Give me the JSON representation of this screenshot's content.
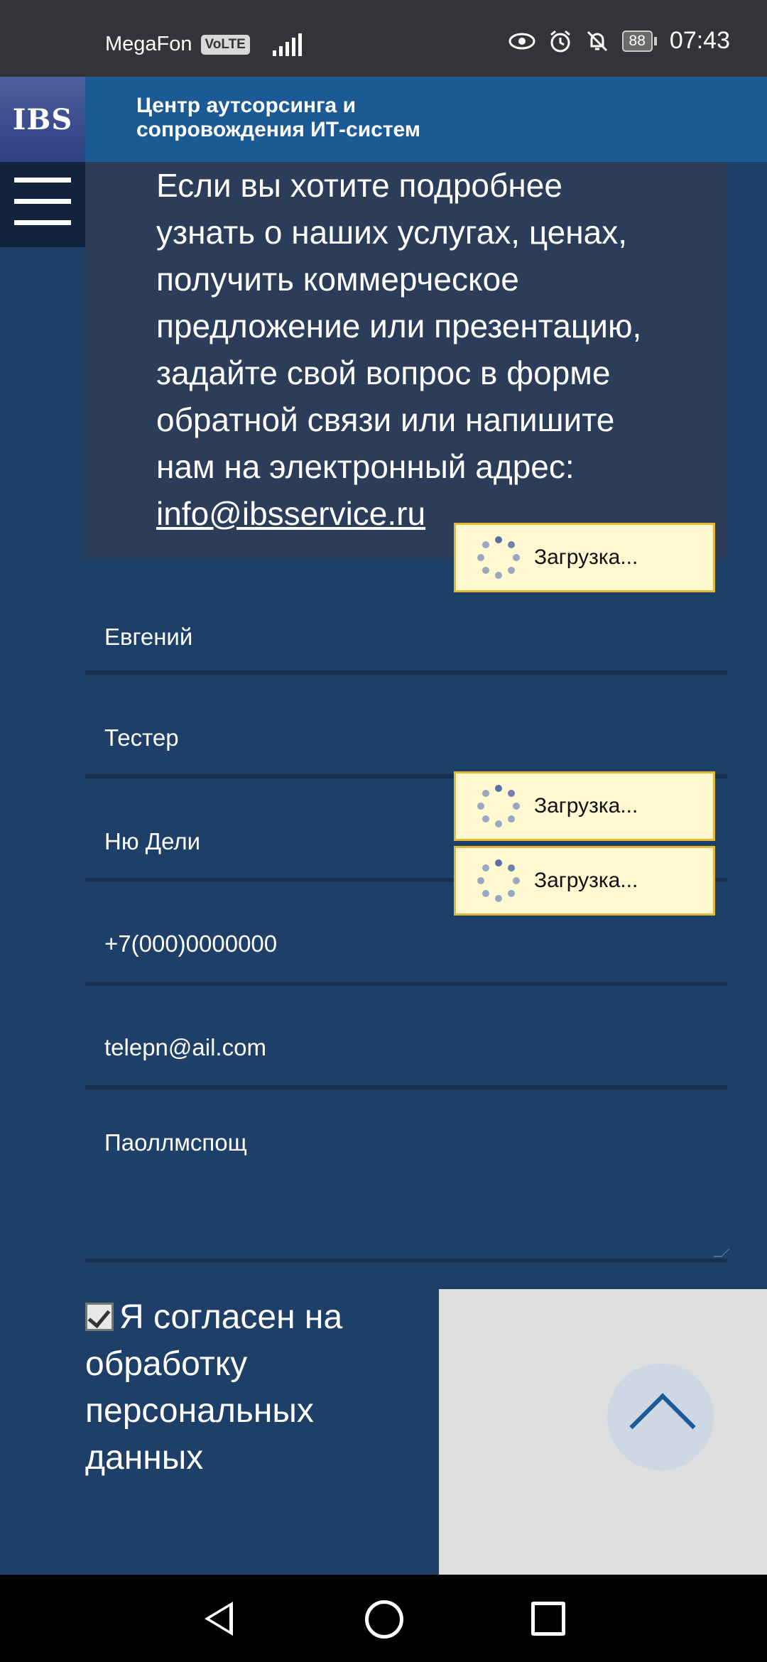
{
  "status_bar": {
    "carrier": "MegaFon",
    "volte": "VoLTE",
    "battery": "88",
    "time": "07:43"
  },
  "header": {
    "logo": "IBS",
    "title_line1": "Центр аутсорсинга и",
    "title_line2": "сопровождения ИТ-систем"
  },
  "info": {
    "line1": "Если вы хотите подробнее",
    "line2": "узнать о наших услугах, ценах,",
    "line3": "получить коммерческое",
    "line4": "предложение или презентацию,",
    "line5": "задайте свой вопрос в форме",
    "line6": "обратной связи или напишите",
    "line7": "нам на электронный адрес:",
    "email": "info@ibsservice.ru"
  },
  "form": {
    "first_name": "Евгений",
    "last_name": "Тестер",
    "city": "Ню Дели",
    "phone": "+7(000)0000000",
    "email": "telepn@ail.com",
    "message": "Паоллмспощ"
  },
  "loading_toasts": [
    {
      "label": "Загрузка..."
    },
    {
      "label": "Загрузка..."
    },
    {
      "label": "Загрузка..."
    }
  ],
  "consent": {
    "checked": true,
    "line1": "Я согласен на",
    "line2": "обработку",
    "line3": "персональных",
    "line4": "данных"
  },
  "colors": {
    "page_bg": "#1e3f68",
    "header_bg": "#1c5a95",
    "info_bg": "#2b3d58",
    "toast_bg": "#fff8d0",
    "toast_border": "#e4b932"
  }
}
